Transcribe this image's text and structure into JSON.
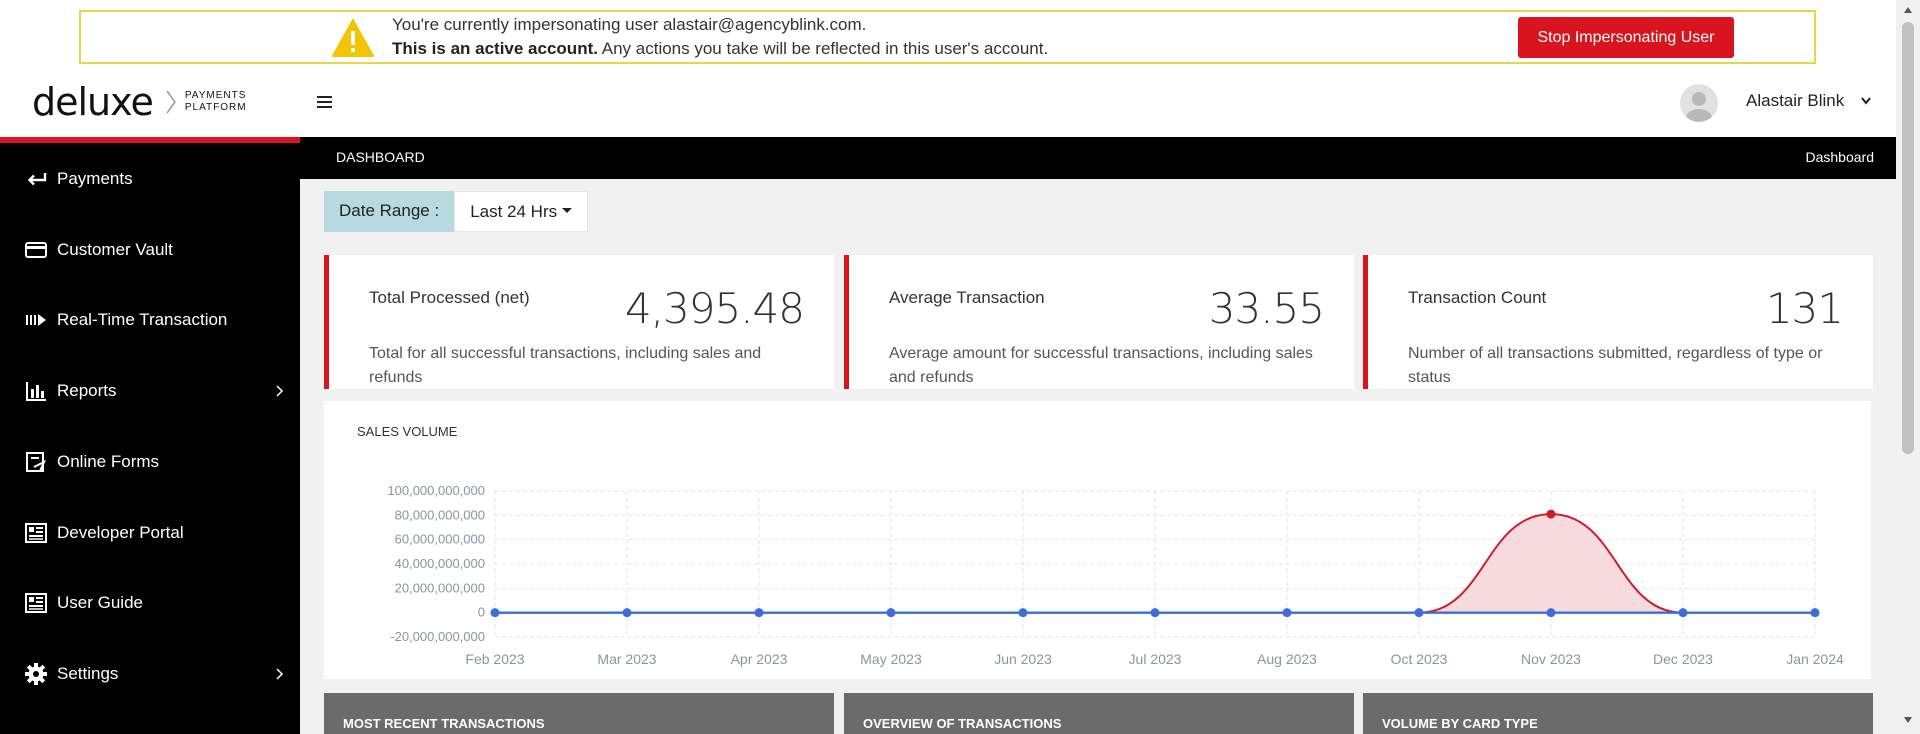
{
  "banner": {
    "line1": "You're currently impersonating user alastair@agencyblink.com.",
    "line2_bold": "This is an active account.",
    "line2_rest": " Any actions you take will be reflected in this user's account.",
    "stop_label": "Stop Impersonating User",
    "colors": {
      "border": "#e7d54a",
      "button": "#d8141f",
      "warning_icon": "#f4c400"
    }
  },
  "header": {
    "logo_word": "deluxe",
    "logo_sub_line1": "PAYMENTS",
    "logo_sub_line2": "PLATFORM",
    "user_name": "Alastair Blink",
    "icons": [
      "hamburger-icon",
      "avatar",
      "chevron-down-icon"
    ]
  },
  "sidebar": {
    "accent_color": "#d8141f",
    "items": [
      {
        "label": "Payments",
        "icon": "arrow-left-icon",
        "has_arrow": false
      },
      {
        "label": "Customer Vault",
        "icon": "credit-card-icon",
        "has_arrow": false
      },
      {
        "label": "Real-Time Transaction",
        "icon": "stream-icon",
        "has_arrow": false
      },
      {
        "label": "Reports",
        "icon": "bar-chart-icon",
        "has_arrow": true
      },
      {
        "label": "Online Forms",
        "icon": "form-icon",
        "has_arrow": false
      },
      {
        "label": "Developer Portal",
        "icon": "document-icon",
        "has_arrow": false
      },
      {
        "label": "User Guide",
        "icon": "document-icon",
        "has_arrow": false
      },
      {
        "label": "Settings",
        "icon": "gear-icon",
        "has_arrow": true
      }
    ]
  },
  "breadcrumb": {
    "left": "DASHBOARD",
    "right": "Dashboard"
  },
  "date_range": {
    "label": "Date Range :",
    "value": "Last 24 Hrs"
  },
  "kpis": [
    {
      "title": "Total Processed (net)",
      "value": "4,395.48",
      "description": "Total for all successful transactions, including sales and refunds"
    },
    {
      "title": "Average Transaction",
      "value": "33.55",
      "description": "Average amount for successful transactions, including sales and refunds"
    },
    {
      "title": "Transaction Count",
      "value": "131",
      "description": "Number of all transactions submitted, regardless of type or status"
    }
  ],
  "chart_data": {
    "type": "line",
    "title": "SALES VOLUME",
    "xlabel": "",
    "ylabel": "",
    "categories": [
      "Feb 2023",
      "Mar 2023",
      "Apr 2023",
      "May 2023",
      "Jun 2023",
      "Jul 2023",
      "Aug 2023",
      "Oct 2023",
      "Nov 2023",
      "Dec 2023",
      "Jan 2024"
    ],
    "y_ticks": [
      "100,000,000,000",
      "80,000,000,000",
      "60,000,000,000",
      "40,000,000,000",
      "20,000,000,000",
      "0",
      "-20,000,000,000"
    ],
    "ylim": [
      -20000000000,
      100000000000
    ],
    "grid": true,
    "series": [
      {
        "color": "#cc1f2a",
        "fill": "#f6d6da",
        "area": true,
        "values": [
          0,
          0,
          0,
          0,
          0,
          0,
          0,
          0,
          81000000000,
          0,
          0
        ]
      },
      {
        "color": "#3b6fd4",
        "area": false,
        "values": [
          0,
          0,
          0,
          0,
          0,
          0,
          0,
          0,
          0,
          0,
          0
        ]
      }
    ]
  },
  "panels": [
    {
      "title": "MOST RECENT TRANSACTIONS"
    },
    {
      "title": "OVERVIEW OF TRANSACTIONS"
    },
    {
      "title": "VOLUME BY CARD TYPE"
    }
  ]
}
